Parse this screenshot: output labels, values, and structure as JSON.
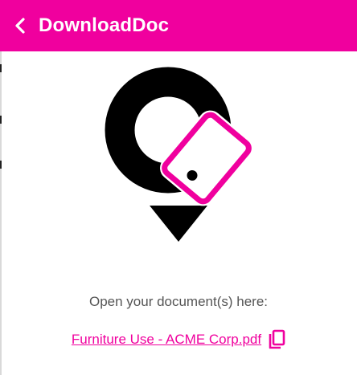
{
  "header": {
    "title": "DownloadDoc",
    "back_icon": "chevron-left-icon",
    "background_color": "#f0009e",
    "text_color": "#ffffff"
  },
  "logo": {
    "icon": "location-pin-with-phone-logo",
    "pin_color": "#000000",
    "phone_color": "#f0009e"
  },
  "main": {
    "prompt_text": "Open your document(s) here:",
    "files": [
      {
        "name": "Furniture Use - ACME Corp.pdf",
        "copy_icon": "copy-icon"
      }
    ],
    "link_color": "#f0009e"
  }
}
